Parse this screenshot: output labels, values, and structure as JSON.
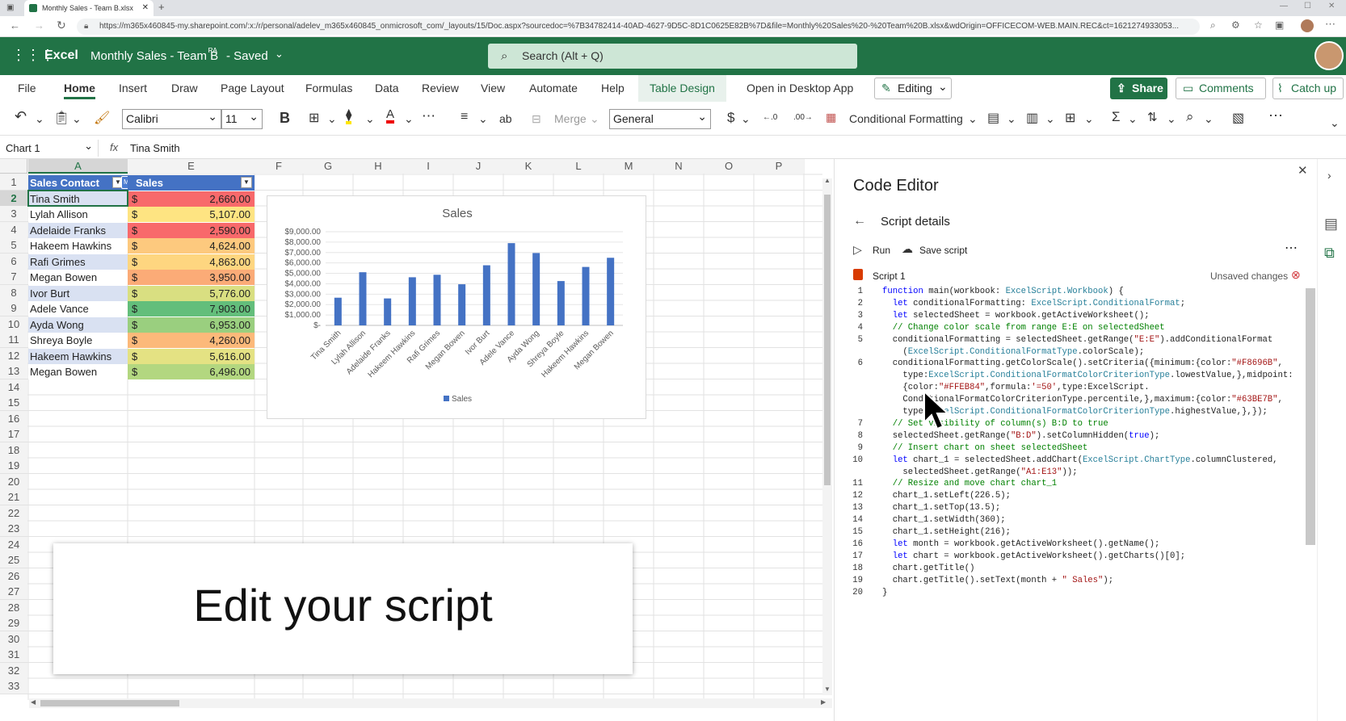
{
  "browser": {
    "tab_title": "Monthly Sales - Team B.xlsx",
    "url": "https://m365x460845-my.sharepoint.com/:x:/r/personal/adelev_m365x460845_onmicrosoft_com/_layouts/15/Doc.aspx?sourcedoc=%7B34782414-40AD-4627-9D5C-8D1C0625E82B%7D&file=Monthly%20Sales%20-%20Team%20B.xlsx&wdOrigin=OFFICECOM-WEB.MAIN.REC&ct=1621274933053..."
  },
  "appbar": {
    "app_name": "Excel",
    "doc_title": "Monthly Sales - Team B",
    "save_status": "- Saved",
    "search_placeholder": "Search (Alt + Q)"
  },
  "ribbon": {
    "tabs": [
      "File",
      "Home",
      "Insert",
      "Draw",
      "Page Layout",
      "Formulas",
      "Data",
      "Review",
      "View",
      "Automate",
      "Help",
      "Table Design"
    ],
    "open_desktop": "Open in Desktop App",
    "editing": "Editing",
    "share": "Share",
    "comments": "Comments",
    "catchup": "Catch up"
  },
  "toolbar": {
    "font": "Calibri",
    "size": "11",
    "bold": "B",
    "merge": "Merge",
    "number_format": "General",
    "currency": "$",
    "cond_format": "Conditional Formatting"
  },
  "formula_bar": {
    "name_box": "Chart 1",
    "fx": "fx",
    "value": "Tina Smith"
  },
  "sheet": {
    "columns": [
      "A",
      "E",
      "F",
      "G",
      "H",
      "I",
      "J",
      "K",
      "L",
      "M",
      "N",
      "O",
      "P"
    ],
    "header_a": "Sales Contact",
    "header_e": "Sales",
    "collab_badge": "MB",
    "currency_symbol": "$",
    "rows": [
      {
        "name": "Tina Smith",
        "value": "2,660.00",
        "color": "#f8696b"
      },
      {
        "name": "Lylah Allison",
        "value": "5,107.00",
        "color": "#fee482"
      },
      {
        "name": "Adelaide Franks",
        "value": "2,590.00",
        "color": "#f8696b"
      },
      {
        "name": "Hakeem Hawkins",
        "value": "4,624.00",
        "color": "#fdc97e"
      },
      {
        "name": "Rafi Grimes",
        "value": "4,863.00",
        "color": "#fed680"
      },
      {
        "name": "Megan Bowen",
        "value": "3,950.00",
        "color": "#fbab77"
      },
      {
        "name": "Ivor Burt",
        "value": "5,776.00",
        "color": "#d9df81"
      },
      {
        "name": "Adele Vance",
        "value": "7,903.00",
        "color": "#63be7b"
      },
      {
        "name": "Ayda Wong",
        "value": "6,953.00",
        "color": "#9acf7f"
      },
      {
        "name": "Shreya Boyle",
        "value": "4,260.00",
        "color": "#fcb97a"
      },
      {
        "name": "Hakeem Hawkins",
        "value": "5,616.00",
        "color": "#e4e283"
      },
      {
        "name": "Megan Bowen",
        "value": "6,496.00",
        "color": "#b3d780"
      }
    ],
    "row_numbers": [
      "1",
      "2",
      "3",
      "4",
      "5",
      "6",
      "7",
      "8",
      "9",
      "10",
      "11",
      "12",
      "13",
      "14",
      "15",
      "16",
      "17",
      "18",
      "19",
      "20",
      "21",
      "22",
      "23",
      "24",
      "25",
      "26",
      "27",
      "28",
      "29",
      "30",
      "31",
      "32",
      "33"
    ]
  },
  "chart_data": {
    "type": "bar",
    "title": "Sales",
    "categories": [
      "Tina Smith",
      "Lylah Allison",
      "Adelaide Franks",
      "Hakeem Hawkins",
      "Rafi Grimes",
      "Megan Bowen",
      "Ivor Burt",
      "Adele Vance",
      "Ayda Wong",
      "Shreya Boyle",
      "Hakeem Hawkins",
      "Megan Bowen"
    ],
    "series": [
      {
        "name": "Sales",
        "values": [
          2660,
          5107,
          2590,
          4624,
          4863,
          3950,
          5776,
          7903,
          6953,
          4260,
          5616,
          6496
        ]
      }
    ],
    "yticks": [
      "$9,000.00",
      "$8,000.00",
      "$7,000.00",
      "$6,000.00",
      "$5,000.00",
      "$4,000.00",
      "$3,000.00",
      "$2,000.00",
      "$1,000.00",
      "$-"
    ],
    "ylim": [
      0,
      9000
    ],
    "grid": true,
    "legend": "bottom",
    "color": "#4472c4"
  },
  "editor": {
    "title": "Code Editor",
    "subtitle": "Script details",
    "run": "Run",
    "save": "Save script",
    "script_name": "Script 1",
    "unsaved": "Unsaved changes",
    "line_numbers": [
      "1",
      "2",
      "3",
      "4",
      "5",
      "",
      "6",
      "",
      "",
      "",
      "",
      "7",
      "8",
      "9",
      "10",
      "",
      "11",
      "12",
      "13",
      "14",
      "15",
      "16",
      "17",
      "18",
      "19",
      "20"
    ],
    "lines": [
      "function main(workbook: ExcelScript.Workbook) {",
      "  let conditionalFormatting: ExcelScript.ConditionalFormat;",
      "  let selectedSheet = workbook.getActiveWorksheet();",
      "  // Change color scale from range E:E on selectedSheet",
      "  conditionalFormatting = selectedSheet.getRange(\"E:E\").addConditionalFormat",
      "    (ExcelScript.ConditionalFormatType.colorScale);",
      "  conditionalFormatting.getColorScale().setCriteria({minimum:{color:\"#F8696B\",",
      "    type:ExcelScript.ConditionalFormatColorCriterionType.lowestValue,},midpoint:",
      "    {color:\"#FFEB84\",formula:'=50',type:ExcelScript.",
      "    ConditionalFormatColorCriterionType.percentile,},maximum:{color:\"#63BE7B\",",
      "    type:ExcelScript.ConditionalFormatColorCriterionType.highestValue,},});",
      "  // Set visibility of column(s) B:D to true",
      "  selectedSheet.getRange(\"B:D\").setColumnHidden(true);",
      "  // Insert chart on sheet selectedSheet",
      "  let chart_1 = selectedSheet.addChart(ExcelScript.ChartType.columnClustered,",
      "    selectedSheet.getRange(\"A1:E13\"));",
      "  // Resize and move chart chart_1",
      "  chart_1.setLeft(226.5);",
      "  chart_1.setTop(13.5);",
      "  chart_1.setWidth(360);",
      "  chart_1.setHeight(216);",
      "  let month = workbook.getActiveWorksheet().getName();",
      "  let chart = workbook.getActiveWorksheet().getCharts()[0];",
      "  chart.getTitle()",
      "  chart.getTitle().setText(month + \" Sales\");",
      "}"
    ]
  },
  "overlay": {
    "caption": "Edit your script"
  }
}
